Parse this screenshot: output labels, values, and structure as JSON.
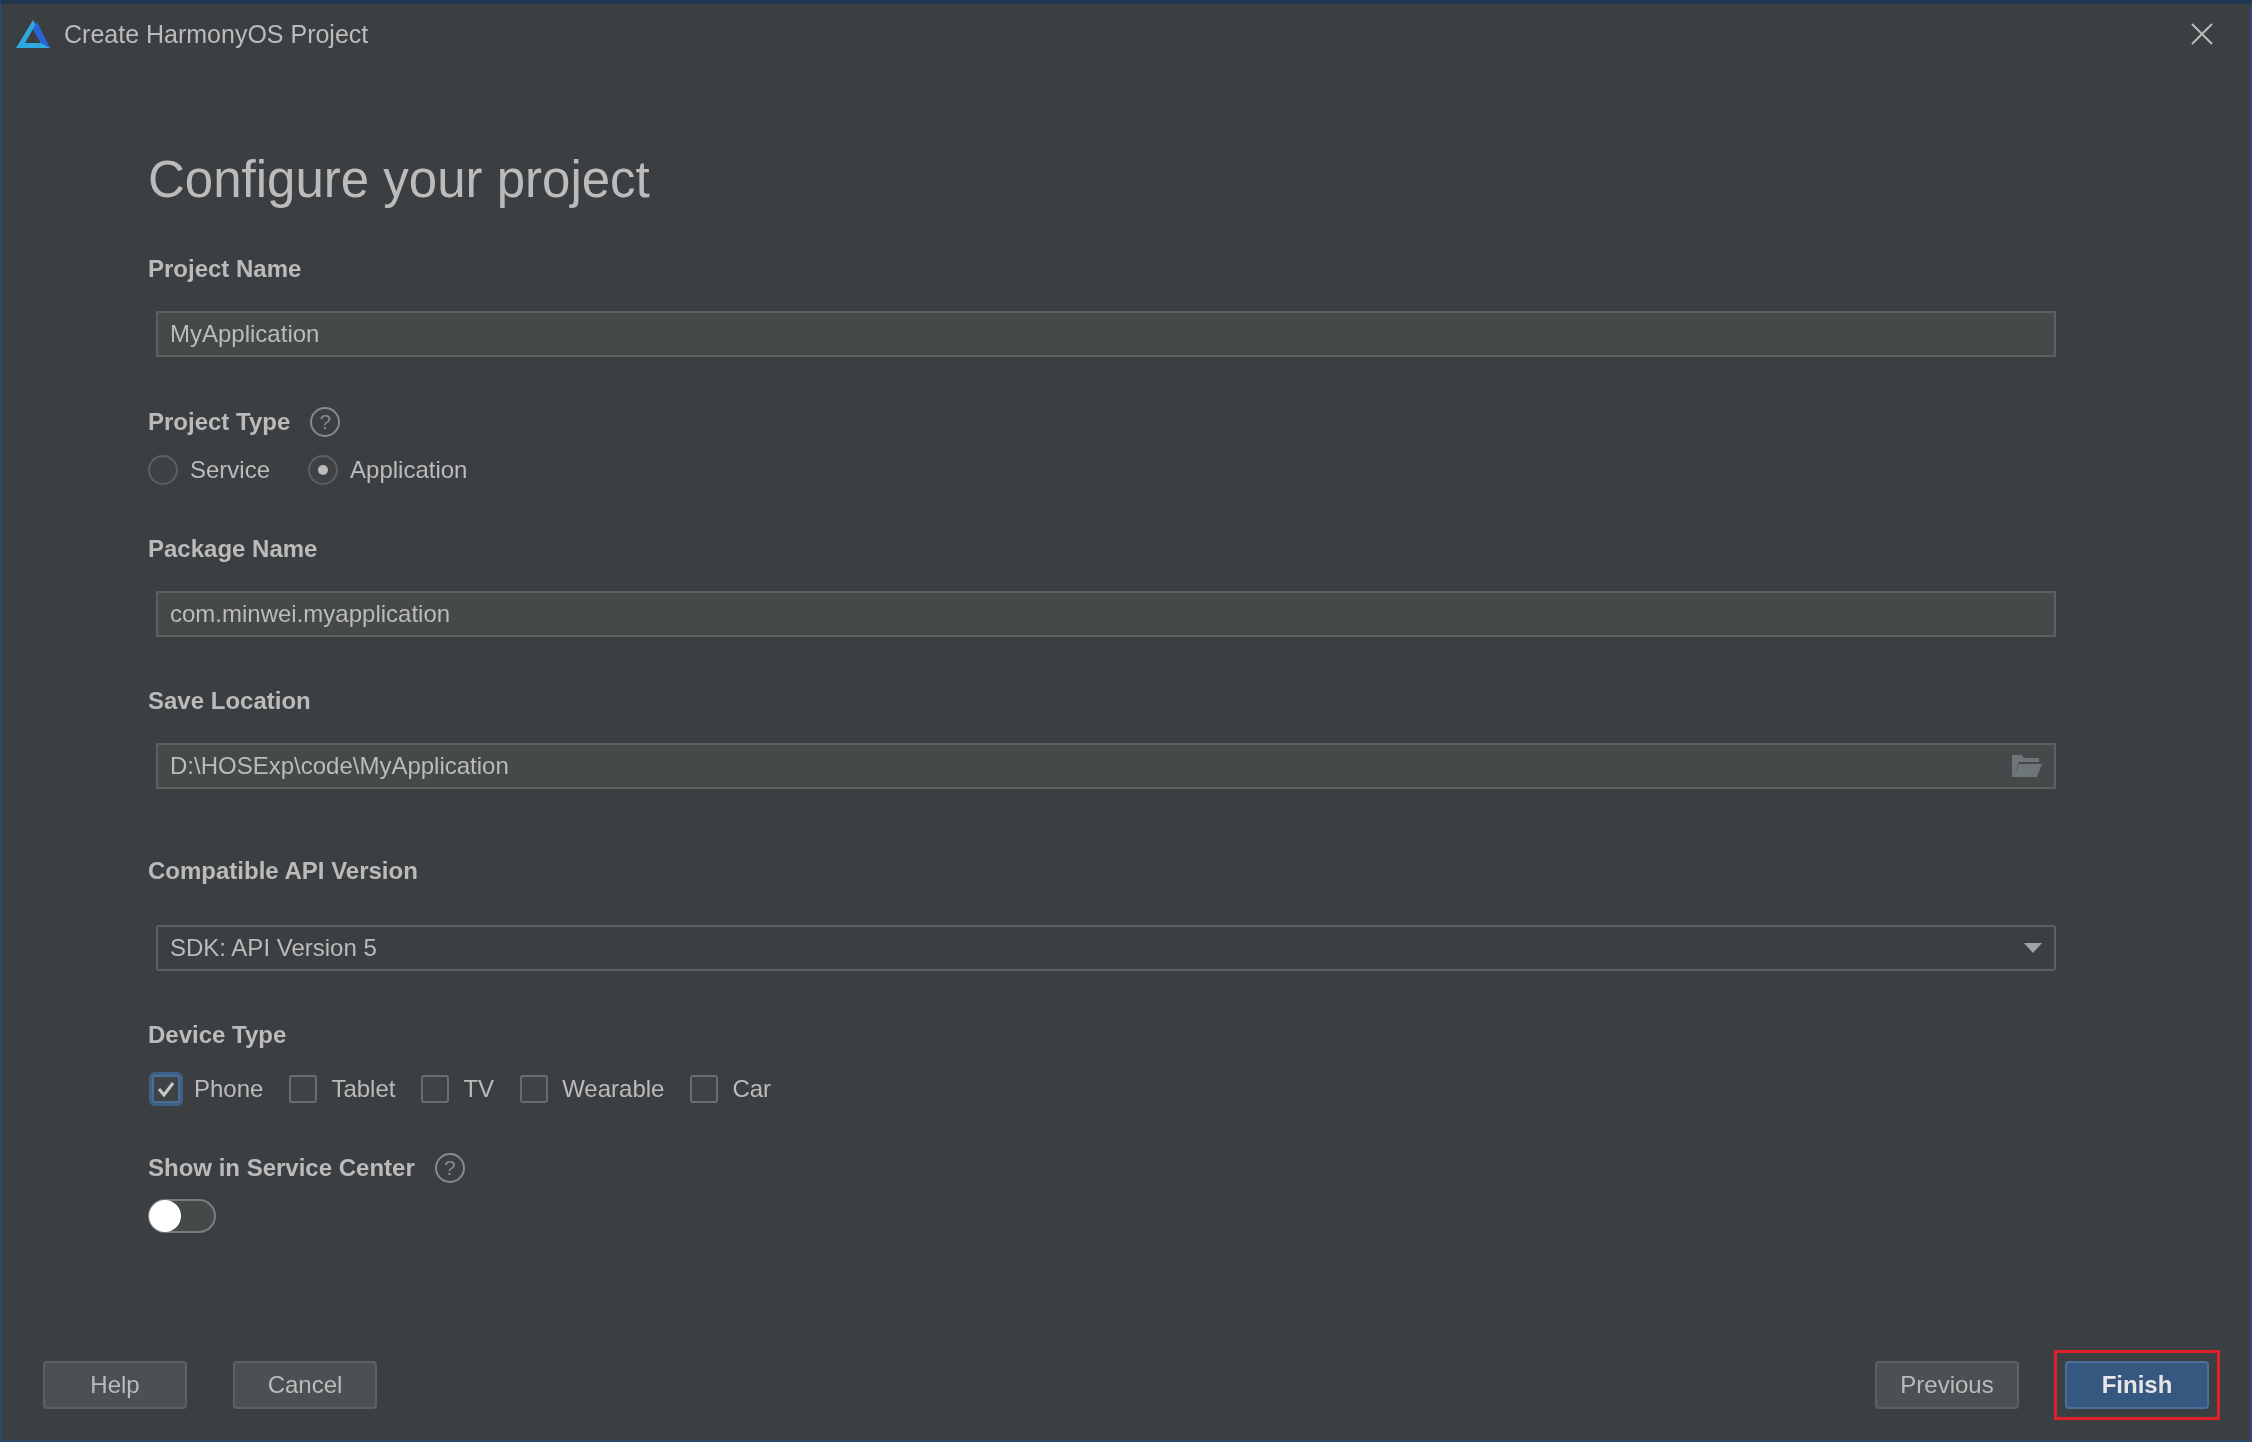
{
  "window": {
    "title": "Create HarmonyOS Project"
  },
  "heading": "Configure your project",
  "sections": [
    {
      "kind": "text",
      "label": "Project Name",
      "value": "MyApplication"
    },
    {
      "kind": "radio",
      "label": "Project Type",
      "help": "?",
      "options": [
        {
          "label": "Service",
          "selected": false
        },
        {
          "label": "Application",
          "selected": true
        }
      ]
    },
    {
      "kind": "text",
      "label": "Package Name",
      "value": "com.minwei.myapplication"
    },
    {
      "kind": "folder",
      "label": "Save Location",
      "value": "D:\\HOSExp\\code\\MyApplication"
    },
    {
      "kind": "dropdown",
      "label": "Compatible API Version",
      "value": "SDK: API Version 5"
    },
    {
      "kind": "checkbox",
      "label": "Device Type",
      "options": [
        {
          "label": "Phone",
          "checked": true,
          "focused": true
        },
        {
          "label": "Tablet",
          "checked": false,
          "focused": false
        },
        {
          "label": "TV",
          "checked": false,
          "focused": false
        },
        {
          "label": "Wearable",
          "checked": false,
          "focused": false
        },
        {
          "label": "Car",
          "checked": false,
          "focused": false
        }
      ]
    },
    {
      "kind": "toggle",
      "label": "Show in Service Center",
      "help": "?",
      "on": false
    }
  ],
  "buttons_left": [
    {
      "label": "Help",
      "primary": false,
      "highlighted": false
    },
    {
      "label": "Cancel",
      "primary": false,
      "highlighted": false
    }
  ],
  "buttons_right": [
    {
      "label": "Previous",
      "primary": false,
      "highlighted": false
    },
    {
      "label": "Finish",
      "primary": true,
      "highlighted": true
    }
  ]
}
